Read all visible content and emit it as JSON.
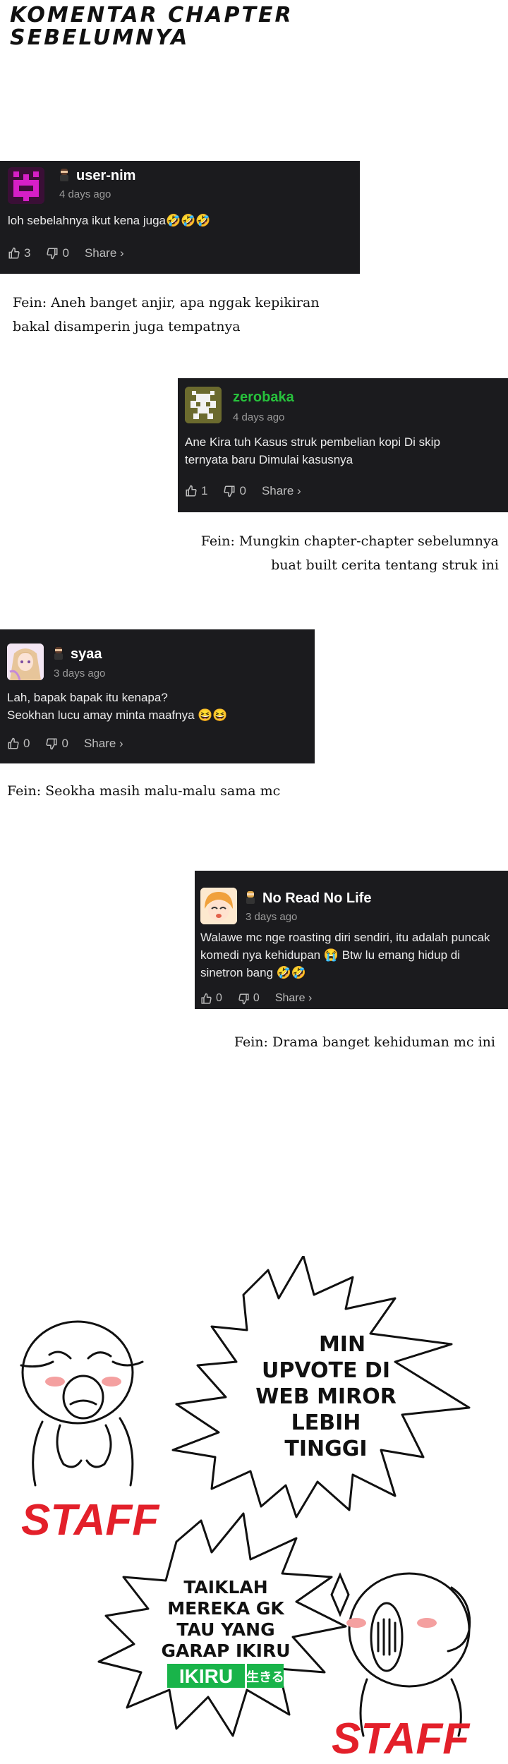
{
  "header": {
    "title_line1": "KOMENTAR CHAPTER",
    "title_line2": "SEBELUMNYA"
  },
  "comments": [
    {
      "username": "user-nim",
      "time": "4 days ago",
      "text": "loh sebelahnya ikut kena juga🤣🤣🤣",
      "upvotes": "3",
      "downvotes": "0",
      "share": "Share ›",
      "note": "Fein: Aneh banget anjir, apa nggak kepikiran\nbakal disamperin juga tempatnya"
    },
    {
      "username": "zerobaka",
      "time": "4 days ago",
      "text": "Ane Kira tuh Kasus struk pembelian kopi Di skip\nternyata baru Dimulai kasusnya",
      "upvotes": "1",
      "downvotes": "0",
      "share": "Share ›",
      "note": "Fein: Mungkin chapter-chapter sebelumnya\nbuat built cerita tentang struk ini"
    },
    {
      "username": "syaa",
      "time": "3 days ago",
      "text": "Lah, bapak bapak itu kenapa?\nSeokhan lucu amay minta maafnya 😆😆",
      "upvotes": "0",
      "downvotes": "0",
      "share": "Share ›",
      "note": "Fein: Seokha masih malu-malu sama mc"
    },
    {
      "username": "No Read No Life",
      "time": "3 days ago",
      "text": "Walawe mc nge roasting diri sendiri, itu adalah puncak\nkomedi nya kehidupan 😭 Btw lu emang hidup di\nsinetron bang 🤣🤣",
      "upvotes": "0",
      "downvotes": "0",
      "share": "Share ›",
      "note": "Fein: Drama banget kehiduman mc ini"
    }
  ],
  "comic": {
    "bubble1": [
      "MIN",
      "UPVOTE DI",
      "WEB MIROR",
      "LEBIH",
      "TINGGI"
    ],
    "bubble2": [
      "TAIKLAH",
      "MEREKA GK",
      "TAU YANG",
      "GARAP IKIRU"
    ],
    "logo_text": "IKIRU",
    "logo_jp": "生きる",
    "staff_left": "STAFF",
    "staff_right": "STAFF"
  },
  "colors": {
    "card_bg": "#1b1b1e",
    "username_highlight": "#27c23c",
    "staff_red": "#e3202a",
    "logo_green": "#19b44a"
  }
}
